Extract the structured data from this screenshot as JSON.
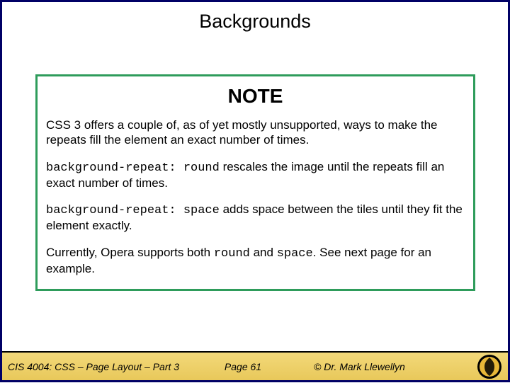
{
  "slide": {
    "title": "Backgrounds",
    "note": {
      "heading": "NOTE",
      "p1": "CSS 3 offers a couple of, as of yet mostly unsupported, ways to make the repeats fill the element an exact number of times.",
      "p2a": "background-repeat: round",
      "p2b": " rescales the image until the repeats fill an exact number of times.",
      "p3a": "background-repeat: space",
      "p3b": " adds space between the tiles until they fit the element exactly.",
      "p4a": "Currently, Opera supports both ",
      "p4b": "round",
      "p4c": " and ",
      "p4d": "space",
      "p4e": ".  See next page for an example."
    }
  },
  "footer": {
    "course": "CIS 4004: CSS – Page Layout – Part 3",
    "page": "Page 61",
    "author": "© Dr. Mark Llewellyn"
  }
}
